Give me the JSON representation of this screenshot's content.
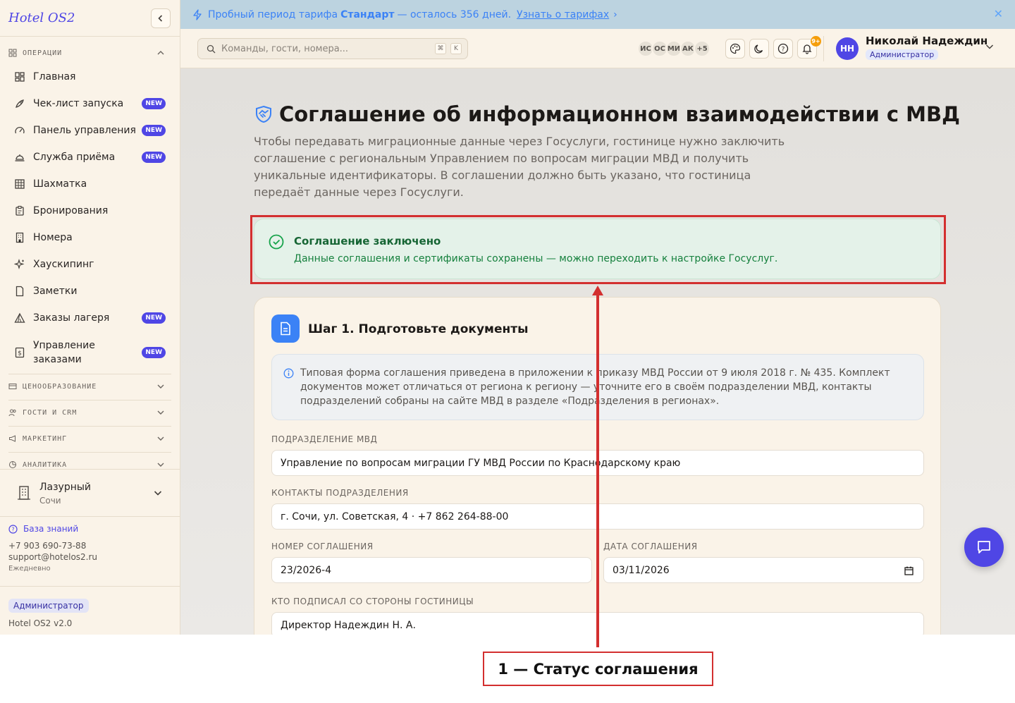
{
  "app": {
    "logo": "Hotel OS2",
    "collapse_icon": "chevron-left-icon"
  },
  "sidebar": {
    "groups": {
      "operations": "ОПЕРАЦИИ",
      "pricing": "ЦЕНООБРАЗОВАНИЕ",
      "guests": "ГОСТИ И CRM",
      "marketing": "МАРКЕТИНГ",
      "analytics": "АНАЛИТИКА"
    },
    "items": [
      {
        "label": "Главная",
        "icon": "dashboard-grid-icon"
      },
      {
        "label": "Чек-лист запуска",
        "icon": "rocket-icon",
        "badge": "NEW"
      },
      {
        "label": "Панель управления",
        "icon": "gauge-icon",
        "badge": "NEW"
      },
      {
        "label": "Служба приёма",
        "icon": "bell-service-icon",
        "badge": "NEW"
      },
      {
        "label": "Шахматка",
        "icon": "grid-table-icon"
      },
      {
        "label": "Бронирования",
        "icon": "clipboard-icon"
      },
      {
        "label": "Номера",
        "icon": "building-icon"
      },
      {
        "label": "Хаускипинг",
        "icon": "sparkles-icon"
      },
      {
        "label": "Заметки",
        "icon": "note-icon"
      },
      {
        "label": "Заказы лагеря",
        "icon": "tent-icon",
        "badge": "NEW"
      },
      {
        "label_line1": "Управление",
        "label_line2": "заказами",
        "icon": "receipt-dollar-icon",
        "badge": "NEW"
      }
    ],
    "hotel": {
      "name": "Лазурный",
      "city": "Сочи"
    },
    "support": {
      "knowledge_base": "База знаний",
      "phone": "+7 903 690-73-88",
      "email": "support@hotelos2.ru",
      "schedule": "Ежедневно"
    },
    "footer": {
      "role": "Администратор",
      "version": "Hotel OS2 v2.0"
    }
  },
  "banner": {
    "text_before": "Пробный период тарифа",
    "plan": "Стандарт",
    "text_after": "— осталось 356 дней.",
    "link": "Узнать о тарифах",
    "link_arrow": "›",
    "close": "✕"
  },
  "topbar": {
    "search_placeholder": "Команды, гости, номера...",
    "kbd1": "⌘",
    "kbd2": "K",
    "avatars": [
      "ИС",
      "ОС",
      "МИ",
      "АК",
      "+5"
    ],
    "notifications_badge": "9+",
    "user": {
      "initials": "НН",
      "name": "Николай Надеждин",
      "role": "Администратор"
    }
  },
  "main": {
    "title": "Соглашение об информационном взаимодействии с МВД",
    "intro": "Чтобы передавать миграционные данные через Госуслуги, гостинице нужно заключить соглашение с региональным Управлением по вопросам миграции МВД и получить уникальные идентификаторы. В соглашении должно быть указано, что гостиница передаёт данные через Госуслуги.",
    "success": {
      "title": "Соглашение заключено",
      "desc": "Данные соглашения и сертификаты сохранены — можно переходить к настройке Госуслуг."
    },
    "step1": {
      "title": "Шаг 1. Подготовьте документы",
      "info": "Типовая форма соглашения приведена в приложении к приказу МВД России от 9 июля 2018 г. № 435. Комплект документов может отличаться от региона к региону — уточните его в своём подразделении МВД, контакты подразделений собраны на сайте МВД в разделе «Подразделения в регионах».",
      "fields": {
        "department_label": "ПОДРАЗДЕЛЕНИЕ МВД",
        "department_value": "Управление по вопросам миграции ГУ МВД России по Краснодарскому краю",
        "contacts_label": "КОНТАКТЫ ПОДРАЗДЕЛЕНИЯ",
        "contacts_value": "г. Сочи, ул. Советская, 4 · +7 862 264-88-00",
        "number_label": "НОМЕР СОГЛАШЕНИЯ",
        "number_value": "23/2026-4",
        "date_label": "ДАТА СОГЛАШЕНИЯ",
        "date_value": "03/11/2026",
        "signer_label": "КТО ПОДПИСАЛ СО СТОРОНЫ ГОСТИНИЦЫ",
        "signer_value": "Директор Надеждин Н. А."
      }
    }
  },
  "annotation": {
    "callout": "1 — Статус соглашения",
    "color": "#d32f2f"
  }
}
